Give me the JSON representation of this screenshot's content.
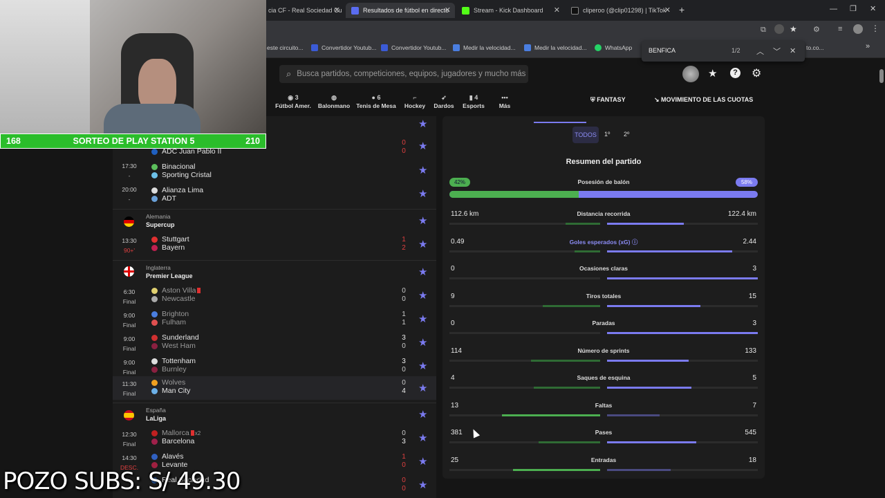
{
  "browser": {
    "tabs": [
      {
        "label": "cia CF - Real Sociedad Cu",
        "active": false
      },
      {
        "label": "Resultados de fútbol en directo",
        "active": true
      },
      {
        "label": "Stream - Kick Dashboard",
        "active": false
      },
      {
        "label": "cliperoo (@clip01298) | TikTok",
        "active": false
      }
    ],
    "bookmarks": [
      "este circuito...",
      "Convertidor Youtub...",
      "Convertidor Youtub...",
      "Medir la velocidad...",
      "Medir la velocidad...",
      "WhatsApp",
      "to.co..."
    ],
    "find": {
      "query": "BENFICA",
      "count": "1/2"
    }
  },
  "header": {
    "search_placeholder": "Busca partidos, competiciones, equipos, jugadores y mucho más",
    "sports": [
      {
        "label": "Fútbol Amer.",
        "count": "3"
      },
      {
        "label": "Balonmano",
        "count": ""
      },
      {
        "label": "Tenis de Mesa",
        "count": "6"
      },
      {
        "label": "Hockey",
        "count": ""
      },
      {
        "label": "Dardos",
        "count": ""
      },
      {
        "label": "Esports",
        "count": "4"
      },
      {
        "label": "Más",
        "count": ""
      }
    ],
    "fantasy": "FANTASY",
    "odds": "MOVIMIENTO DE LAS CUOTAS"
  },
  "matches": {
    "peru": [
      {
        "time": "",
        "status": "",
        "home": "",
        "away": "ADC Juan Pablo II",
        "hs": "0",
        "as": "0"
      },
      {
        "time": "17:30",
        "status": "-",
        "home": "Binacional",
        "away": "Sporting Cristal",
        "hs": "",
        "as": ""
      },
      {
        "time": "20:00",
        "status": "-",
        "home": "Alianza Lima",
        "away": "ADT",
        "hs": "",
        "as": ""
      }
    ],
    "germany": {
      "country": "Alemania",
      "league": "Supercup",
      "games": [
        {
          "time": "13:30",
          "status": "90+'",
          "home": "Stuttgart",
          "away": "Bayern",
          "hs": "1",
          "as": "2"
        }
      ]
    },
    "england": {
      "country": "Inglaterra",
      "league": "Premier League",
      "games": [
        {
          "time": "6:30",
          "status": "Final",
          "home": "Aston Villa",
          "away": "Newcastle",
          "hs": "0",
          "as": "0"
        },
        {
          "time": "9:00",
          "status": "Final",
          "home": "Brighton",
          "away": "Fulham",
          "hs": "1",
          "as": "1"
        },
        {
          "time": "9:00",
          "status": "Final",
          "home": "Sunderland",
          "away": "West Ham",
          "hs": "3",
          "as": "0"
        },
        {
          "time": "9:00",
          "status": "Final",
          "home": "Tottenham",
          "away": "Burnley",
          "hs": "3",
          "as": "0"
        },
        {
          "time": "11:30",
          "status": "Final",
          "home": "Wolves",
          "away": "Man City",
          "hs": "0",
          "as": "4"
        }
      ]
    },
    "spain": {
      "country": "España",
      "league": "LaLiga",
      "games": [
        {
          "time": "12:30",
          "status": "Final",
          "home": "Mallorca",
          "away": "Barcelona",
          "hs": "0",
          "as": "3",
          "note": "x2"
        },
        {
          "time": "14:30",
          "status": "DESC.",
          "home": "Alavés",
          "away": "Levante",
          "hs": "1",
          "as": "0"
        },
        {
          "time": "",
          "status": "",
          "home": "Real Sociedad",
          "away": "Real Sociedad",
          "hs": "0",
          "as": "0"
        }
      ]
    }
  },
  "stats": {
    "filters": [
      "TODOS",
      "1º",
      "2º"
    ],
    "title": "Resumen del partido",
    "possession": {
      "label": "Posesión de balón",
      "home": "42%",
      "away": "58%",
      "home_frac": 0.42
    },
    "rows": [
      {
        "name": "Distancia recorrida",
        "home": "112.6 km",
        "away": "122.4 km",
        "hf": 0.23,
        "af": 0.51
      },
      {
        "name": "Goles esperados (xG)",
        "home": "0.49",
        "away": "2.44",
        "hf": 0.17,
        "af": 0.83
      },
      {
        "name": "Ocasiones claras",
        "home": "0",
        "away": "3",
        "hf": 0.0,
        "af": 1.0
      },
      {
        "name": "Tiros totales",
        "home": "9",
        "away": "15",
        "hf": 0.38,
        "af": 0.62
      },
      {
        "name": "Paradas",
        "home": "0",
        "away": "3",
        "hf": 0.0,
        "af": 1.0
      },
      {
        "name": "Número de sprints",
        "home": "114",
        "away": "133",
        "hf": 0.46,
        "af": 0.54
      },
      {
        "name": "Saques de esquina",
        "home": "4",
        "away": "5",
        "hf": 0.44,
        "af": 0.56
      },
      {
        "name": "Faltas",
        "home": "13",
        "away": "7",
        "hf": 0.65,
        "af": 0.35
      },
      {
        "name": "Pases",
        "home": "381",
        "away": "545",
        "hf": 0.41,
        "af": 0.59
      },
      {
        "name": "Entradas",
        "home": "25",
        "away": "18",
        "hf": 0.58,
        "af": 0.42
      }
    ]
  },
  "overlay": {
    "giveaway": {
      "left": "168",
      "text": "SORTEO DE PLAY STATION 5",
      "right": "210"
    },
    "pozo": "POZO SUBS: S/ 49.30"
  },
  "colors": {
    "home": "#3f9a43",
    "away": "#7b7bf0",
    "star": "#7b7bf0"
  }
}
